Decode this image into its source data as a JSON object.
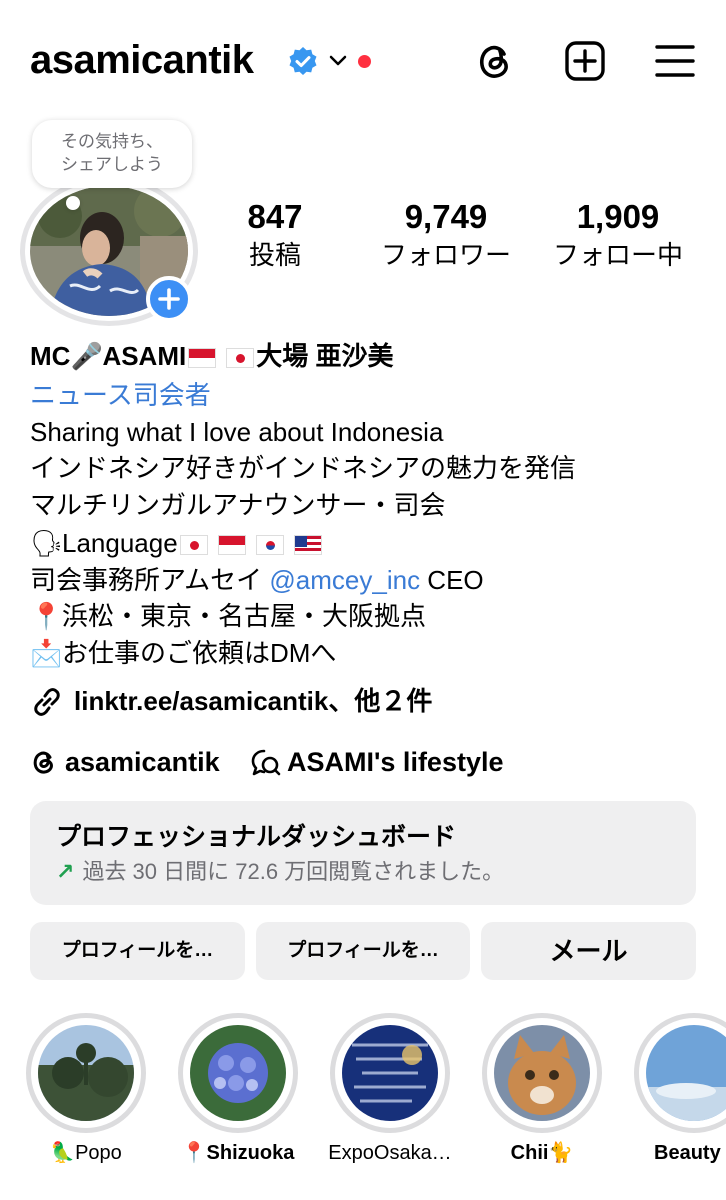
{
  "header": {
    "username": "asamicantik",
    "icons": [
      "verified-badge-icon",
      "chevron-down-icon",
      "threads-icon",
      "create-post-icon",
      "menu-icon"
    ],
    "accent_color": "#3897f0",
    "notification_dot_color": "#ff3040"
  },
  "profile": {
    "note_line1": "その気持ち、",
    "note_line2": "シェアしよう",
    "stats": [
      {
        "value": "847",
        "label": "投稿"
      },
      {
        "value": "9,749",
        "label": "フォロワー"
      },
      {
        "value": "1,909",
        "label": "フォロー中"
      }
    ]
  },
  "bio": {
    "name_prefix": "MC",
    "name_mid": "ASAMI",
    "name_suffix": "大場 亜沙美",
    "category": "ニュース司会者",
    "line1": "Sharing what I love about Indonesia",
    "line2": "インドネシア好きがインドネシアの魅力を発信",
    "line3": "マルチリンガルアナウンサー・司会",
    "line4": "Language",
    "line5_prefix": "司会事務所アムセイ ",
    "line5_mention": "@amcey_inc",
    "line5_suffix": " CEO",
    "line6": "浜松・東京・名古屋・大阪拠点",
    "line7": "お仕事のご依頼はDMへ",
    "link_color": "#3a7bd5"
  },
  "links": {
    "link_text": "linktr.ee/asamicantik、他２件",
    "threads_handle": "asamicantik",
    "channel_name": "ASAMI's lifestyle"
  },
  "dashboard": {
    "title": "プロフェッショナルダッシュボード",
    "subtitle": "過去 30 日間に 72.6 万回閲覧されました。",
    "trend_icon": "↗"
  },
  "buttons": {
    "edit_profile": "プロフィールを…",
    "share_profile": "プロフィールを…",
    "email": "メール"
  },
  "highlights": [
    {
      "label": "🦜Popo"
    },
    {
      "label": "📍Shizuoka"
    },
    {
      "label": "ExpoOsaka…"
    },
    {
      "label": "Chii🐈"
    },
    {
      "label": "Beauty"
    }
  ]
}
